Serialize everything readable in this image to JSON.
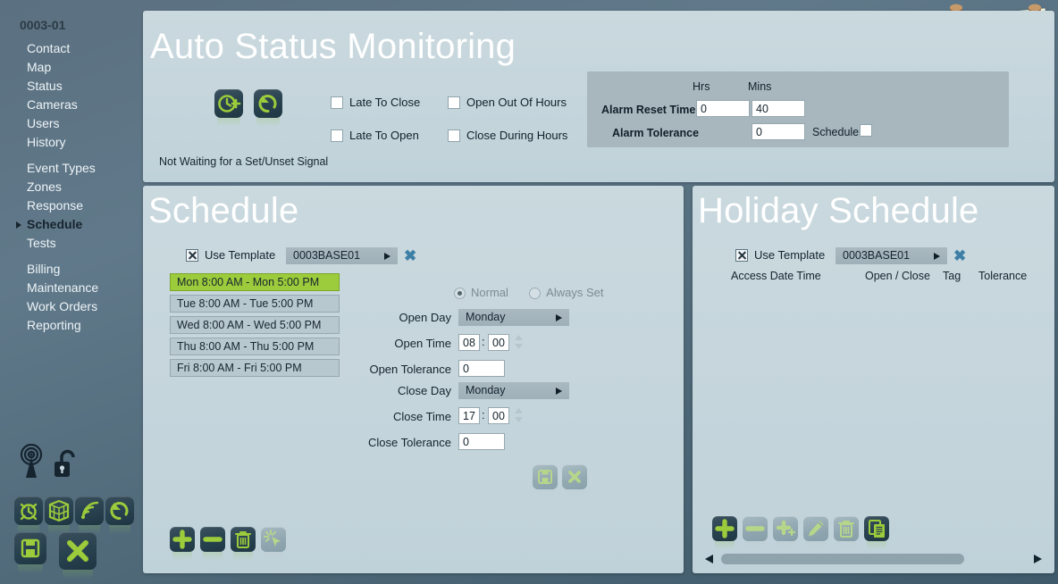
{
  "sidebar": {
    "site_id": "0003-01",
    "items": [
      {
        "label": "Contact",
        "active": false
      },
      {
        "label": "Map",
        "active": false
      },
      {
        "label": "Status",
        "active": false
      },
      {
        "label": "Cameras",
        "active": false
      },
      {
        "label": "Users",
        "active": false
      },
      {
        "label": "History",
        "active": false
      },
      {
        "label": "Event Types",
        "active": false,
        "gap_before": true
      },
      {
        "label": "Zones",
        "active": false
      },
      {
        "label": "Response",
        "active": false
      },
      {
        "label": "Schedule",
        "active": true
      },
      {
        "label": "Tests",
        "active": false
      },
      {
        "label": "Billing",
        "active": false,
        "gap_before": true
      },
      {
        "label": "Maintenance",
        "active": false
      },
      {
        "label": "Work Orders",
        "active": false
      },
      {
        "label": "Reporting",
        "active": false
      }
    ],
    "plain_icons": [
      "signal-tower-icon",
      "unlocked-padlock-icon"
    ],
    "buttons": [
      "alarm-clock-icon",
      "grid-cube-icon",
      "wifi-signal-icon",
      "refresh-icon"
    ],
    "save_label": "save-icon",
    "cancel_label": "cancel-icon"
  },
  "header": {
    "title": "Auto Status Monitoring",
    "action_buttons": [
      "clock-add-icon",
      "undo-refresh-icon"
    ],
    "checkboxes": [
      {
        "label": "Late To Close",
        "checked": false
      },
      {
        "label": "Late To Open",
        "checked": false
      },
      {
        "label": "Open Out Of Hours",
        "checked": false
      },
      {
        "label": "Close During Hours",
        "checked": false
      }
    ],
    "status_text": "Not Waiting for a Set/Unset Signal",
    "alarm": {
      "hrs_header": "Hrs",
      "mins_header": "Mins",
      "reset_time_label": "Alarm Reset Time",
      "reset_hrs": "0",
      "reset_mins": "40",
      "tolerance_label": "Alarm Tolerance",
      "tolerance_value": "0",
      "schedule_label": "Schedule",
      "schedule_checked": false
    }
  },
  "schedule": {
    "title": "Schedule",
    "use_template_label": "Use Template",
    "use_template_checked": true,
    "template_value": "0003BASE01",
    "days": [
      {
        "label": "Mon 8:00 AM - Mon 5:00 PM",
        "selected": true
      },
      {
        "label": "Tue 8:00 AM - Tue 5:00 PM",
        "selected": false
      },
      {
        "label": "Wed 8:00 AM - Wed 5:00 PM",
        "selected": false
      },
      {
        "label": "Thu 8:00 AM - Thu 5:00 PM",
        "selected": false
      },
      {
        "label": "Fri 8:00 AM - Fri 5:00 PM",
        "selected": false
      }
    ],
    "mode": {
      "normal_label": "Normal",
      "always_set_label": "Always Set",
      "selected": "Normal"
    },
    "form": {
      "open_day_label": "Open Day",
      "open_day_value": "Monday",
      "open_time_label": "Open Time",
      "open_time_hh": "08",
      "open_time_mm": "00",
      "open_tol_label": "Open Tolerance",
      "open_tol_value": "0",
      "close_day_label": "Close Day",
      "close_day_value": "Monday",
      "close_time_label": "Close Time",
      "close_time_hh": "17",
      "close_time_mm": "00",
      "close_tol_label": "Close Tolerance",
      "close_tol_value": "0",
      "save_icon": "save-icon",
      "cancel_icon": "cancel-icon"
    },
    "toolbar": [
      {
        "icon": "plus-icon",
        "enabled": true
      },
      {
        "icon": "minus-icon",
        "enabled": true
      },
      {
        "icon": "trash-icon",
        "enabled": true
      },
      {
        "icon": "select-click-icon",
        "enabled": false
      }
    ]
  },
  "holiday": {
    "title": "Holiday Schedule",
    "use_template_label": "Use Template",
    "use_template_checked": true,
    "template_value": "0003BASE01",
    "columns": [
      "Access Date Time",
      "Open / Close",
      "Tag",
      "Tolerance"
    ],
    "rows": [],
    "toolbar": [
      {
        "icon": "plus-icon",
        "enabled": true
      },
      {
        "icon": "minus-icon",
        "enabled": false
      },
      {
        "icon": "plus-star-icon",
        "enabled": false
      },
      {
        "icon": "pencil-icon",
        "enabled": false
      },
      {
        "icon": "trash-icon",
        "enabled": false
      },
      {
        "icon": "copy-icon",
        "enabled": true
      }
    ]
  },
  "colors": {
    "accent_green": "#9ccb3b",
    "panel_bg": "#c5d5dc",
    "app_bg": "#5b7080",
    "alarm_box_bg": "#a8b7be",
    "link_blue": "#3d7fa6"
  }
}
